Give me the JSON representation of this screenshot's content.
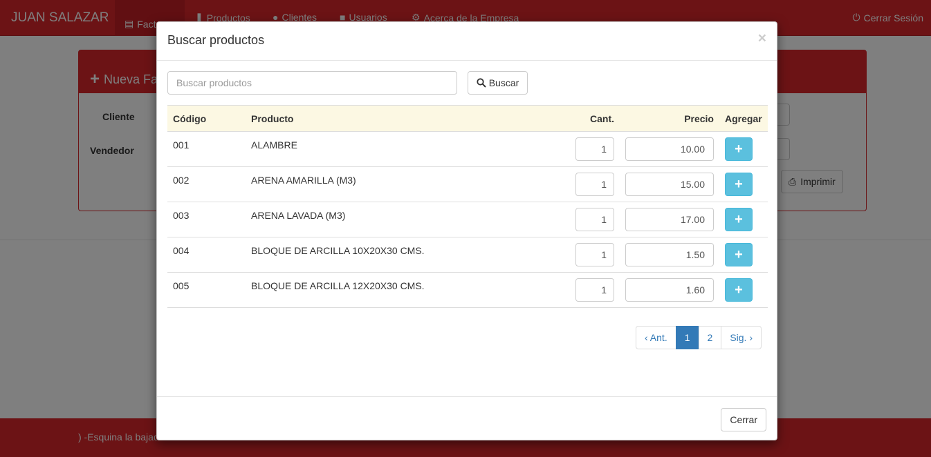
{
  "navbar": {
    "brand": "JUAN SALAZAR",
    "items": [
      {
        "label": "Facturas",
        "icon": "list-icon"
      },
      {
        "label": "Productos",
        "icon": "barcode-icon"
      },
      {
        "label": "Clientes",
        "icon": "user-icon"
      },
      {
        "label": "Usuarios",
        "icon": "lock-icon"
      },
      {
        "label": "Acerca de la Empresa",
        "icon": "gear-icon"
      }
    ],
    "logout": "Cerrar Sesión"
  },
  "background": {
    "panel_title": "Nueva Fa",
    "cliente_label": "Cliente",
    "vendedor_label": "Vendedor",
    "print_label": "Imprimir",
    "footer_text": ") -Esquina la bajad"
  },
  "modal": {
    "title": "Buscar productos",
    "close": "×",
    "search_placeholder": "Buscar productos",
    "search_button": "Buscar",
    "columns": {
      "code": "Código",
      "product": "Producto",
      "qty": "Cant.",
      "price": "Precio",
      "add": "Agregar"
    },
    "rows": [
      {
        "code": "001",
        "product": "ALAMBRE",
        "qty": "1",
        "price": "10.00"
      },
      {
        "code": "002",
        "product": "ARENA AMARILLA (M3)",
        "qty": "1",
        "price": "15.00"
      },
      {
        "code": "003",
        "product": "ARENA LAVADA (M3)",
        "qty": "1",
        "price": "17.00"
      },
      {
        "code": "004",
        "product": "BLOQUE DE ARCILLA 10X20X30 CMS.",
        "qty": "1",
        "price": "1.50"
      },
      {
        "code": "005",
        "product": "BLOQUE DE ARCILLA 12X20X30 CMS.",
        "qty": "1",
        "price": "1.60"
      }
    ],
    "pagination": {
      "prev": "‹ Ant.",
      "pages": [
        "1",
        "2"
      ],
      "current": "1",
      "next": "Sig. ›"
    },
    "footer_close": "Cerrar"
  },
  "colors": {
    "brand_red": "#d9262b",
    "info": "#5bc0de",
    "primary": "#337ab7",
    "table_head": "#fcf8e3"
  }
}
